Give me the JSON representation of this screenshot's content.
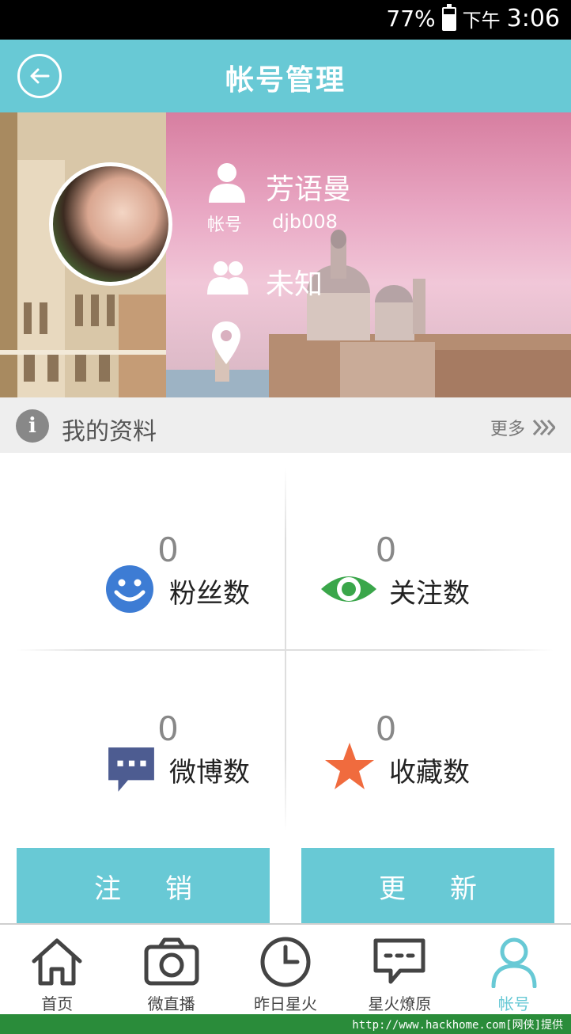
{
  "status_bar": {
    "battery_percent": "77%",
    "ampm": "下午",
    "time": "3:06"
  },
  "header": {
    "title": "帐号管理",
    "back_icon": "back-arrow-icon"
  },
  "profile": {
    "name": "芳语曼",
    "account_label": "帐号",
    "account_value": "djb008",
    "gender": "未知",
    "location": ""
  },
  "my_info": {
    "title": "我的资料",
    "more": "更多"
  },
  "stats": [
    {
      "count": "0",
      "label": "粉丝数",
      "icon": "smiley-icon",
      "color": "#3d7cd4"
    },
    {
      "count": "0",
      "label": "关注数",
      "icon": "eye-icon",
      "color": "#3aa64a"
    },
    {
      "count": "0",
      "label": "微博数",
      "icon": "message-icon",
      "color": "#4d5c91"
    },
    {
      "count": "0",
      "label": "收藏数",
      "icon": "star-icon",
      "color": "#f06b3e"
    }
  ],
  "actions": {
    "logout": "注销",
    "update": "更新"
  },
  "nav": {
    "items": [
      {
        "label": "首页",
        "icon": "home-icon"
      },
      {
        "label": "微直播",
        "icon": "camera-icon"
      },
      {
        "label": "昨日星火",
        "icon": "clock-icon"
      },
      {
        "label": "星火燎原",
        "icon": "chat-icon"
      },
      {
        "label": "帐号",
        "icon": "person-icon"
      }
    ],
    "active": "帐号"
  },
  "footer": {
    "watermark": "http://www.hackhome.com[网侠]提供"
  },
  "colors": {
    "accent": "#68c9d5",
    "status_bg": "#000000",
    "footer_bg": "#2a8c3a"
  }
}
